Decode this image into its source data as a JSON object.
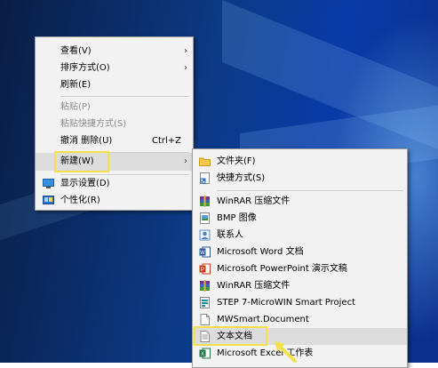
{
  "context_menu": {
    "items": [
      {
        "label": "查看(V)",
        "has_submenu": true
      },
      {
        "label": "排序方式(O)",
        "has_submenu": true
      },
      {
        "label": "刷新(E)"
      },
      {
        "label": "粘贴(P)",
        "disabled": true
      },
      {
        "label": "粘贴快捷方式(S)",
        "disabled": true
      },
      {
        "label": "撤消 删除(U)",
        "shortcut": "Ctrl+Z"
      },
      {
        "label": "新建(W)",
        "has_submenu": true,
        "highlighted": true
      },
      {
        "label": "显示设置(D)",
        "icon": "display-settings-icon"
      },
      {
        "label": "个性化(R)",
        "icon": "personalize-icon"
      }
    ],
    "submenu_arrow": "›"
  },
  "new_submenu": {
    "items": [
      {
        "label": "文件夹(F)",
        "icon": "folder-icon"
      },
      {
        "label": "快捷方式(S)",
        "icon": "shortcut-icon"
      },
      {
        "label": "WinRAR 压缩文件",
        "icon": "winrar-icon"
      },
      {
        "label": "BMP 图像",
        "icon": "bmp-image-icon"
      },
      {
        "label": "联系人",
        "icon": "contact-icon"
      },
      {
        "label": "Microsoft Word 文档",
        "icon": "word-icon"
      },
      {
        "label": "Microsoft PowerPoint 演示文稿",
        "icon": "powerpoint-icon"
      },
      {
        "label": "WinRAR 压缩文件",
        "icon": "winrar-icon"
      },
      {
        "label": "STEP 7-MicroWIN Smart Project",
        "icon": "step7-project-icon"
      },
      {
        "label": "MWSmart.Document",
        "icon": "document-icon"
      },
      {
        "label": "文本文档",
        "icon": "text-document-icon",
        "highlighted": true
      },
      {
        "label": "Microsoft Excel 工作表",
        "icon": "excel-icon"
      }
    ]
  },
  "colors": {
    "highlight_box": "#f5e04a",
    "menu_bg": "#f2f2f2",
    "desktop_blue": "#0c3a86"
  }
}
